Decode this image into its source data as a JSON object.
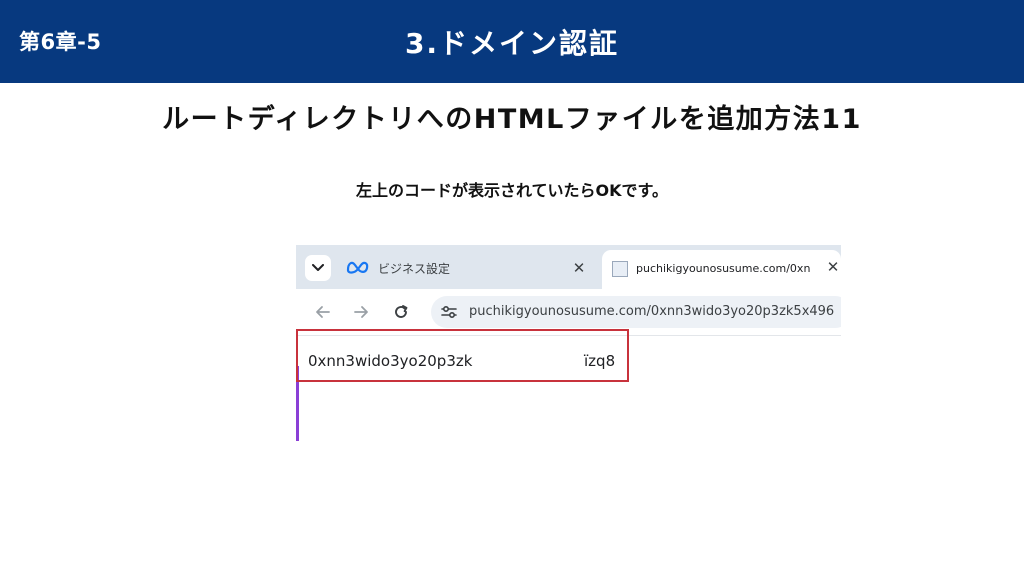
{
  "header": {
    "chapter": "第6章-5",
    "title": "3.ドメイン認証"
  },
  "subtitle": "ルートディレクトリへのHTMLファイルを追加方法11",
  "note": "左上のコードが表示されていたらOKです。",
  "browser": {
    "tabs": [
      {
        "label": "ビジネス設定",
        "icon": "meta-icon",
        "active": false
      },
      {
        "label": "puchikigyounosusume.com/0xn",
        "icon": "site-favicon",
        "active": true
      }
    ],
    "close_glyph": "✕",
    "url": "puchikigyounosusume.com/0xnn3wido3yo20p3zk5x496",
    "page_text_start": "0xnn3wido3yo20p3zk",
    "page_text_end": "ïzq8"
  },
  "colors": {
    "header_bg": "#07397f",
    "highlight_border": "#c8323c",
    "purple_accent": "#8a3fd6"
  }
}
